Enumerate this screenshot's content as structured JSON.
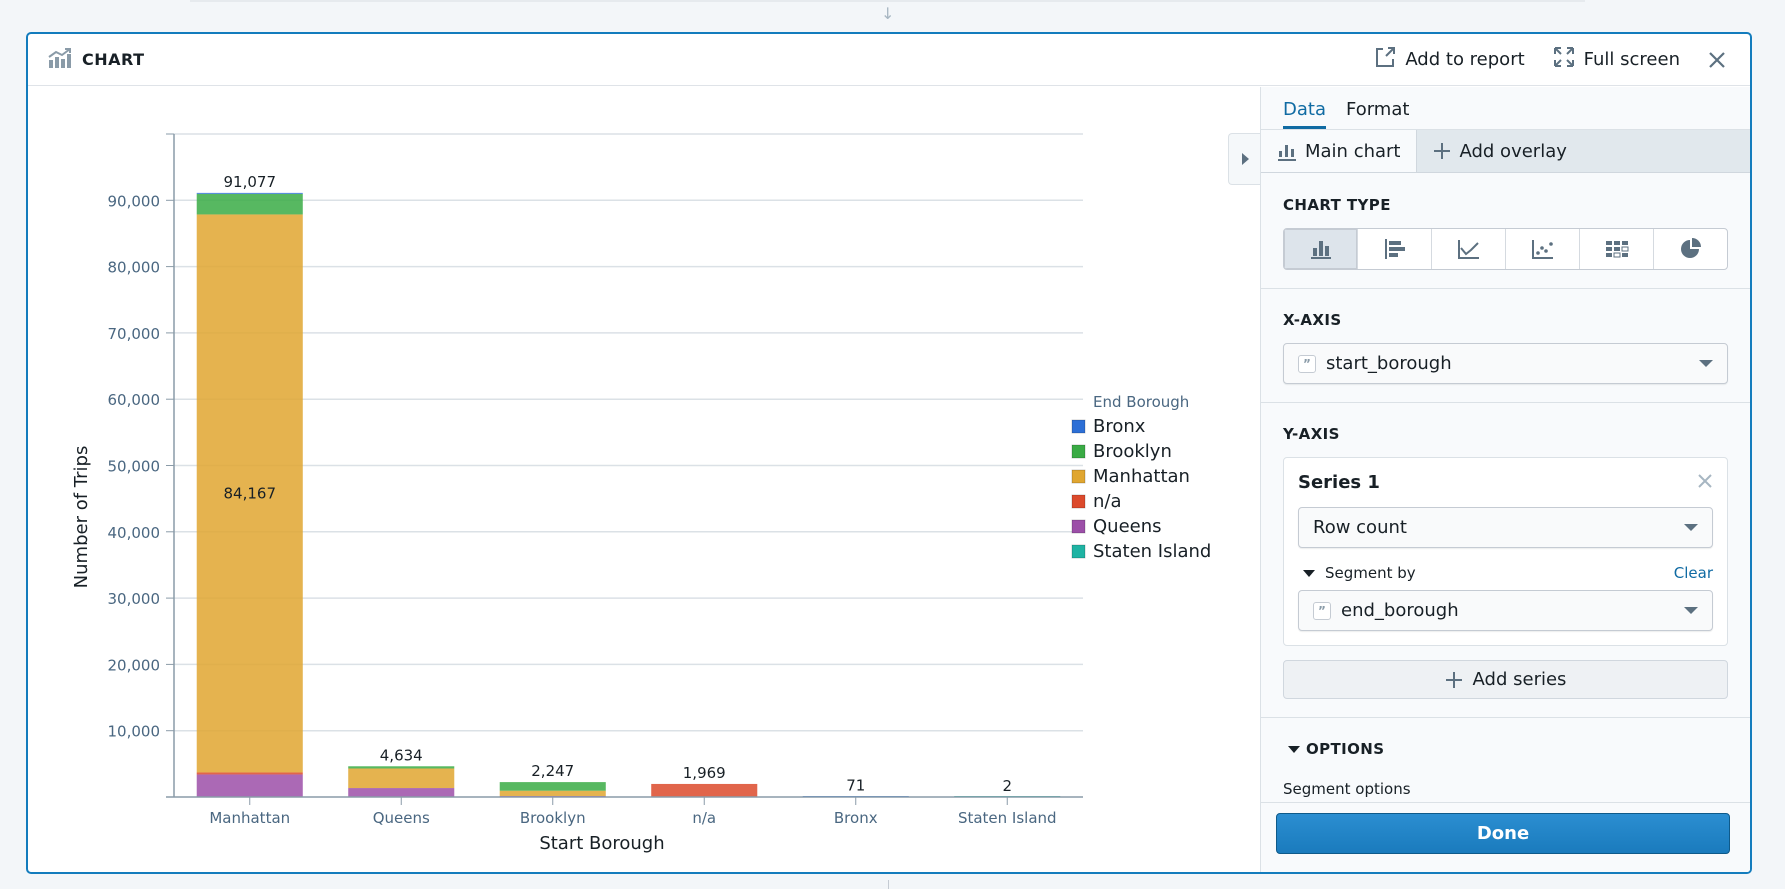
{
  "header": {
    "title": "CHART",
    "add_to_report": "Add to report",
    "full_screen": "Full screen"
  },
  "side_panel": {
    "tabs": [
      {
        "label": "Data",
        "active": true
      },
      {
        "label": "Format",
        "active": false
      }
    ],
    "sub_tabs": {
      "main_chart": "Main chart",
      "add_overlay": "Add overlay"
    },
    "chart_type": {
      "label": "CHART TYPE",
      "options": [
        "vertical-bar",
        "horizontal-bar",
        "line",
        "scatter",
        "heatmap-grid",
        "pie"
      ],
      "selected": "vertical-bar"
    },
    "x_axis": {
      "label": "X-AXIS",
      "value": "start_borough"
    },
    "y_axis": {
      "label": "Y-AXIS",
      "series": [
        {
          "title": "Series 1",
          "aggregation": "Row count",
          "segment_by_label": "Segment by",
          "clear_label": "Clear",
          "segment_value": "end_borough"
        }
      ],
      "add_series": "Add series"
    },
    "options": {
      "label": "OPTIONS",
      "segment_options": "Segment options"
    },
    "done": "Done"
  },
  "colors": {
    "accent": "#137cbd",
    "Bronx": "#2d6fd6",
    "Brooklyn": "#3aab45",
    "Manhattan": "#e0a630",
    "n/a": "#dc4a2c",
    "Queens": "#9c4fa8",
    "Staten Island": "#1fb3a3"
  },
  "chart_data": {
    "type": "bar",
    "stacked": true,
    "title": "",
    "xlabel": "Start Borough",
    "ylabel": "Number of Trips",
    "ylim": [
      0,
      100000
    ],
    "yticks": [
      10000,
      20000,
      30000,
      40000,
      50000,
      60000,
      70000,
      80000,
      90000
    ],
    "ytick_labels": [
      "10,000",
      "20,000",
      "30,000",
      "40,000",
      "50,000",
      "60,000",
      "70,000",
      "80,000",
      "90,000"
    ],
    "grid": true,
    "legend_title": "End Borough",
    "legend_position": "right",
    "categories": [
      "Manhattan",
      "Queens",
      "Brooklyn",
      "n/a",
      "Bronx",
      "Staten Island"
    ],
    "totals": [
      91077,
      4634,
      2247,
      1969,
      71,
      2
    ],
    "total_labels": [
      "91,077",
      "4,634",
      "2,247",
      "1,969",
      "71",
      "2"
    ],
    "inner_labels": [
      {
        "category": "Manhattan",
        "series": "Manhattan",
        "text": "84,167"
      }
    ],
    "series": [
      {
        "name": "Queens",
        "values": [
          3400,
          1350,
          150,
          0,
          0,
          0
        ]
      },
      {
        "name": "n/a",
        "values": [
          300,
          0,
          0,
          1969,
          0,
          0
        ]
      },
      {
        "name": "Manhattan",
        "values": [
          84167,
          2950,
          800,
          0,
          0,
          0
        ]
      },
      {
        "name": "Staten Island",
        "values": [
          0,
          0,
          0,
          0,
          0,
          2
        ]
      },
      {
        "name": "Brooklyn",
        "values": [
          3100,
          334,
          1297,
          0,
          0,
          0
        ]
      },
      {
        "name": "Bronx",
        "values": [
          110,
          0,
          0,
          0,
          71,
          0
        ]
      }
    ],
    "legend_order": [
      "Bronx",
      "Brooklyn",
      "Manhattan",
      "n/a",
      "Queens",
      "Staten Island"
    ]
  }
}
